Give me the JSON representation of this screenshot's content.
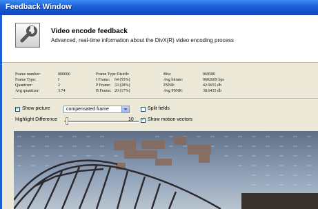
{
  "window": {
    "title": "Feedback Window"
  },
  "header": {
    "icon": "wrench-icon",
    "title": "Video encode feedback",
    "subtitle": "Advanced, real-time information about the DivX(R) video encoding process"
  },
  "stats": {
    "col1": [
      {
        "label": "Frame number:",
        "value": "000000"
      },
      {
        "label": "Frame Type:",
        "value": "I"
      },
      {
        "label": "Quantizer:",
        "value": "2"
      },
      {
        "label": "Avg quantizer:",
        "value": "3.74"
      }
    ],
    "col2": [
      {
        "label": "Frame Type Distrib:",
        "value": ""
      },
      {
        "label": "I Frame:",
        "value": "64 (55%)"
      },
      {
        "label": "P Frame:",
        "value": "33 (28%)"
      },
      {
        "label": "B Frame:",
        "value": "20 (17%)"
      }
    ],
    "col3": [
      {
        "label": "Bits:",
        "value": "969580"
      },
      {
        "label": "Avg bitrate:",
        "value": "9602609 bps"
      },
      {
        "label": "PSNR:",
        "value": "42.9655 db"
      },
      {
        "label": "Avg PSNR:",
        "value": "38.6435 db"
      }
    ]
  },
  "controls": {
    "show_picture": {
      "label": "Show picture",
      "checked": true
    },
    "picture_mode": {
      "selected": "compensated frame"
    },
    "split_fields": {
      "label": "Split fields",
      "checked": false
    },
    "highlight": {
      "label": "Highlight Difference",
      "value": "10",
      "level": 0.0
    },
    "show_motion_vectors": {
      "label": "Show motion vectors",
      "checked": true
    }
  }
}
